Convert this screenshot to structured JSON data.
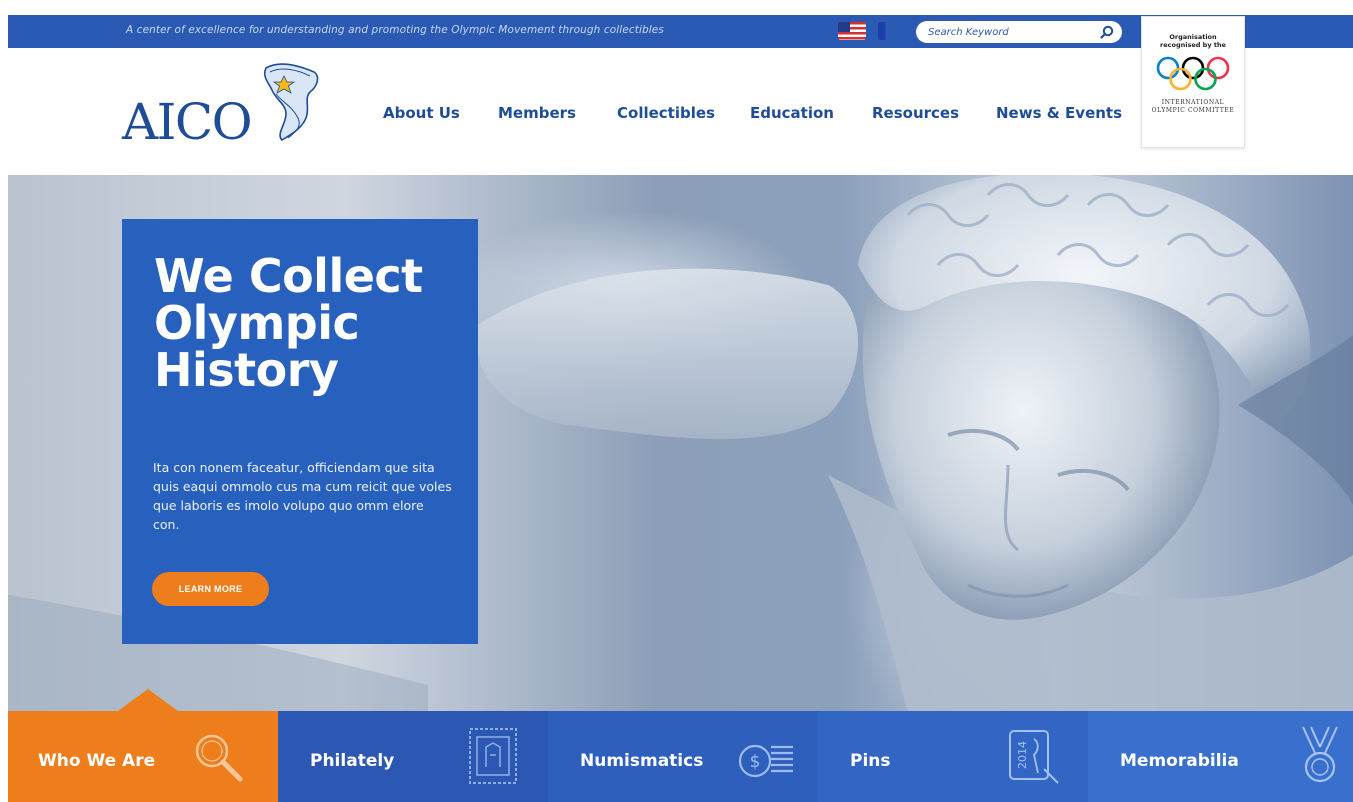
{
  "topbar": {
    "tagline": "A center of excellence for understanding and promoting the Olympic Movement through collectibles",
    "search_placeholder": "Search Keyword",
    "languages": [
      {
        "name": "English",
        "icon": "us-flag-icon"
      },
      {
        "name": "French",
        "icon": "france-flag-icon"
      }
    ]
  },
  "ioc_badge": {
    "top_text": "Organisation recognised by the",
    "bottom_text": "INTERNATIONAL OLYMPIC COMMITTEE",
    "ring_colors": [
      "#0081c8",
      "#000000",
      "#ee334e",
      "#fcb131",
      "#00a651"
    ]
  },
  "logo": {
    "text": "AICO",
    "brand_color": "#1e4c97"
  },
  "nav": {
    "items": [
      "About Us",
      "Members",
      "Collectibles",
      "Education",
      "Resources",
      "News & Events"
    ]
  },
  "hero": {
    "title_lines": [
      "We Collect",
      "Olympic",
      "History"
    ],
    "body": "Ita con nonem faceatur, officiendam que sita quis eaqui ommolo cus ma cum reicit que voles que laboris es imolo volupo quo omm elore con.",
    "cta": "LEARN MORE",
    "card_color": "#2860be",
    "cta_color": "#ee7d1c"
  },
  "categories": [
    {
      "label": "Who We Are",
      "icon": "magnifier-icon",
      "color": "#ee7d1c",
      "active": true
    },
    {
      "label": "Philately",
      "icon": "stamp-icon",
      "color": "#2c58b3",
      "active": false
    },
    {
      "label": "Numismatics",
      "icon": "coin-icon",
      "color": "#2e5fbd",
      "active": false
    },
    {
      "label": "Pins",
      "icon": "pin-icon",
      "color": "#3366c4",
      "active": false
    },
    {
      "label": "Memorabilia",
      "icon": "medal-icon",
      "color": "#3a70cd",
      "active": false
    }
  ]
}
